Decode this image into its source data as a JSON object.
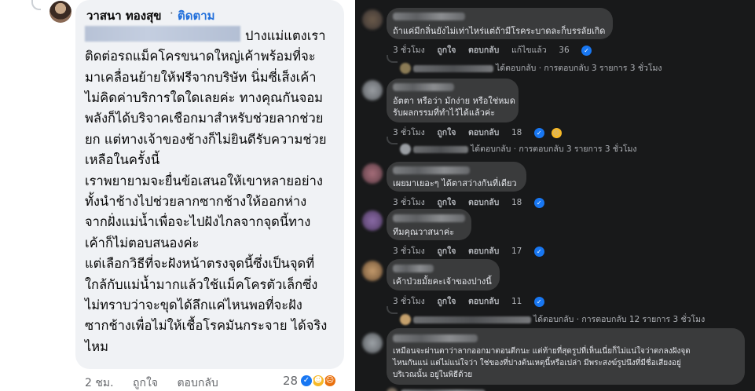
{
  "left": {
    "author_name": "วาสนา ทองสุข",
    "dot": "·",
    "follow_label": "ติดตาม",
    "lines": [
      "ปางแม่แตงเรา",
      "ติดต่อรถแม็คโครขนาดใหญ่เค้าพร้อมที่จะ",
      "มาเคลื่อนย้ายให้ฟรีจากบริษัท นิ่มซี่เส็งเค้า",
      "ไม่คิดค่าบริการใดใดเลยค่ะ ทางคุณกันจอม",
      "พลังก็ได้บริจาคเชือกมาสำหรับช่วยลากช่วย",
      "ยก แต่ทางเจ้าของช้างก็ไม่ยินดีรับความช่วย",
      "เหลือในครั้งนี้",
      "เราพยายามจะยื่นข้อเสนอให้เขาหลายอย่าง",
      "ทั้งนำช้างไปช่วยลากซากช้างให้ออกห่าง",
      "จากฝั่งแม่น้ำเพื่อจะไปฝังไกลจากจุดนี้ทาง",
      "เค้าก็ไม่ตอบสนองค่ะ",
      "แต่เลือกวิธีที่จะฝังหน้าตรงจุดนี้ซึ่งเป็นจุดที่",
      "ใกล้กับแม่น้ำมากแล้วใช้แม็คโครตัวเล็กซึ่ง",
      "ไม่ทราบว่าจะขุดได้ลึกแค่ไหนพอที่จะฝัง",
      "ซากช้างเพื่อไม่ให้เชื้อโรคมันกระจาย ได้จริง",
      "ไหม"
    ],
    "footer": {
      "time": "2 ชม.",
      "like": "ถูกใจ",
      "reply": "ตอบกลับ"
    },
    "reaction_count": "28"
  },
  "right": {
    "comments": [
      {
        "text_lines": [
          "ถ้าแค่มีกลิ่นยังไม่เท่าไหร่แต่ถ้ามีโรคระบาดละก็บรรลัยเกิด"
        ],
        "time": "3 ชั่วโมง",
        "like": "ถูกใจ",
        "reply": "ตอบกลับ",
        "extra": "แก้ไขแล้ว",
        "count": "36"
      },
      {
        "text_lines": [
          "อัตตา หรือว่า มักง่าย หรือใช่หมด",
          "รับผลกรรมที่ทำไว้ได้แล้วค่ะ"
        ],
        "time": "3 ชั่วโมง",
        "like": "ถูกใจ",
        "reply": "ตอบกลับ",
        "extra": "",
        "count": "18"
      },
      {
        "text_lines": [
          "เผยมาเยอะๆ ได้ตาสว่างกันที่เดียว"
        ],
        "time": "3 ชั่วโมง",
        "like": "ถูกใจ",
        "reply": "ตอบกลับ",
        "extra": "",
        "count": "18"
      },
      {
        "text_lines": [
          "ทีมคุณวาสนาค่ะ"
        ],
        "time": "3 ชั่วโมง",
        "like": "ถูกใจ",
        "reply": "ตอบกลับ",
        "extra": "",
        "count": "17"
      },
      {
        "text_lines": [
          "เค้าป่วยมั้ยคะเจ้าของปางนี้"
        ],
        "time": "3 ชั่วโมง",
        "like": "ถูกใจ",
        "reply": "ตอบกลับ",
        "extra": "",
        "count": "11"
      },
      {
        "text_lines": [
          "เหมือนจะผ่านตาว่าลากออกมาตอนตีกนะ แต่ท้ายที่สุดรูปที่เห็นเนี่ยก็ไม่แน่ใจว่าตกลงฝังจุด",
          "ไหนกันแน่ แต่ไม่แน่ใจว่า ใช่ของที่ปางต้นเหตุนี้หรือเปล่า มีพระสงฆ์รูปนึงที่มีชื่อเสียงอยู่",
          "บริเวณนั้น อยู่ในพิธีด้วย"
        ],
        "time": "",
        "like": "",
        "reply": "",
        "extra": "",
        "count": ""
      }
    ],
    "reply_rows": [
      {
        "replied": "ได้ตอบกลับ",
        "summary": "· การตอบกลับ 3 รายการ",
        "time": "3 ชั่วโมง"
      },
      {
        "replied": "ได้ตอบกลับ",
        "summary": "· การตอบกลับ 3 รายการ",
        "time": "3 ชั่วโมง"
      },
      {
        "replied": "ได้ตอบกลับ",
        "summary": "· การตอบกลับ 12 รายการ",
        "time": "3 ชั่วโมง"
      }
    ]
  },
  "colors": {
    "follow": "#216fdb",
    "like_blue": "#1877f2",
    "dark_bg": "#18191a",
    "dark_bubble": "#3a3b3c"
  }
}
